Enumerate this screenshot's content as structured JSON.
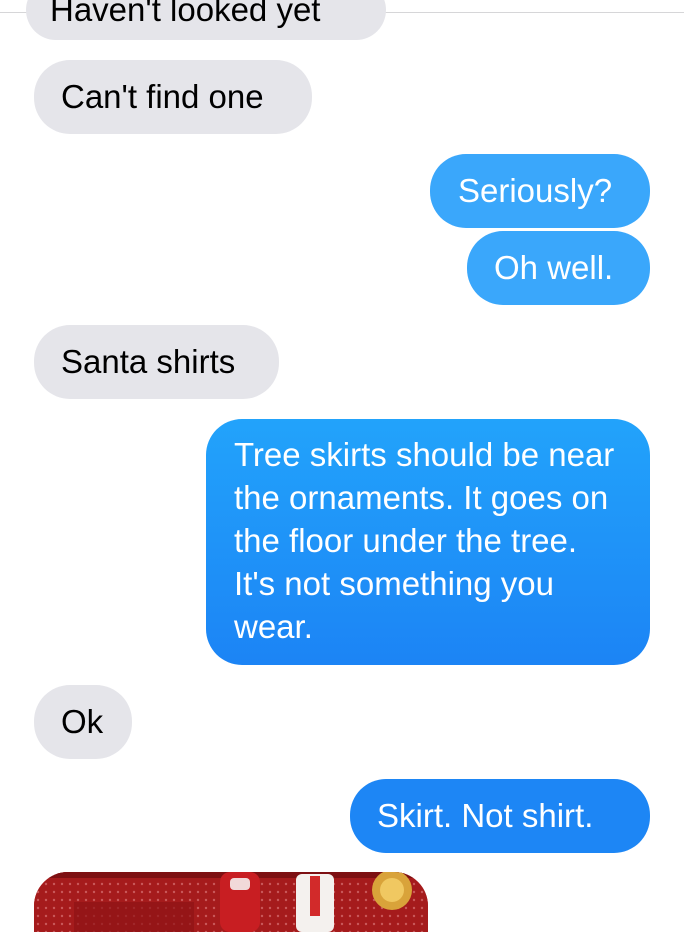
{
  "messages": [
    {
      "id": "m0",
      "direction": "incoming",
      "text": "Haven't looked yet",
      "clipped": true
    },
    {
      "id": "m1",
      "direction": "incoming",
      "text": "Can't find one"
    },
    {
      "id": "m2",
      "direction": "outgoing",
      "text": "Seriously?"
    },
    {
      "id": "m3",
      "direction": "outgoing",
      "text": "Oh well."
    },
    {
      "id": "m4",
      "direction": "incoming",
      "text": "Santa shirts"
    },
    {
      "id": "m5",
      "direction": "outgoing",
      "text": "Tree skirts should be near the ornaments. It goes on the floor under the tree. It's not something you wear."
    },
    {
      "id": "m6",
      "direction": "incoming",
      "text": "Ok"
    },
    {
      "id": "m7",
      "direction": "outgoing",
      "text": "Skirt. Not shirt."
    }
  ],
  "attachment": {
    "type": "photo",
    "visible": "partial"
  },
  "colors": {
    "incoming_bubble": "#e5e5ea",
    "outgoing_bubble": "#2291f8",
    "incoming_text": "#000000",
    "outgoing_text": "#ffffff",
    "photo_base": "#a51b1c"
  }
}
